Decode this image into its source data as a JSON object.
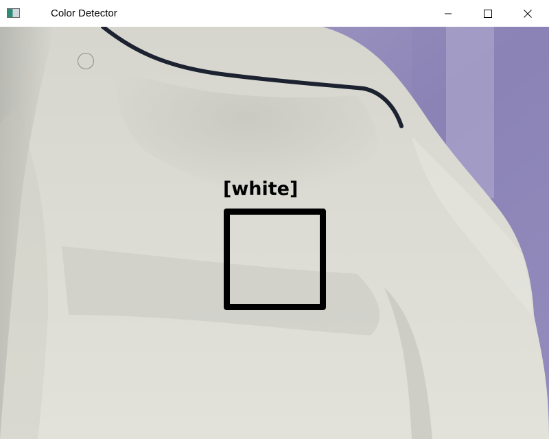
{
  "window": {
    "title": "Color Detector",
    "icons": {
      "app": "app-icon",
      "minimize": "minimize-icon",
      "maximize": "maximize-icon",
      "close": "close-icon"
    }
  },
  "camera": {
    "detected_label": "[white]",
    "box_color": "#000000",
    "scene_colors": {
      "shirt": "#d9d9cf",
      "shadow": "#b9b9b2",
      "background_wall": "#8f86b8",
      "cord": "#1c2230"
    }
  }
}
